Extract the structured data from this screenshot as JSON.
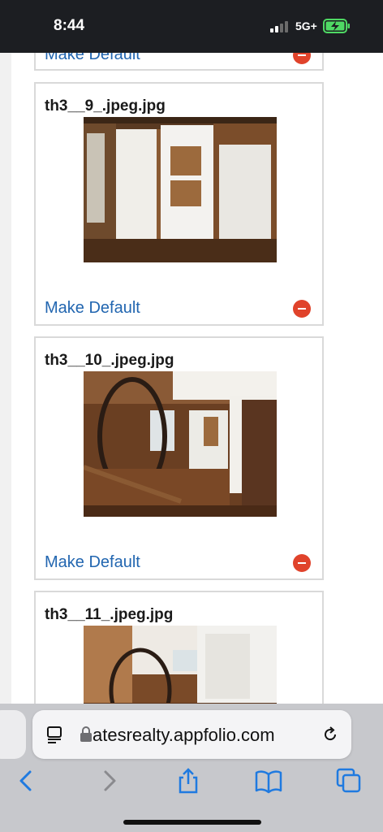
{
  "status_bar": {
    "time": "8:44",
    "network": "5G+"
  },
  "listing_photos": [
    {
      "filename": "",
      "action_label": "Make Default"
    },
    {
      "filename": "th3__9_.jpeg.jpg",
      "action_label": "Make Default"
    },
    {
      "filename": "th3__10_.jpeg.jpg",
      "action_label": "Make Default"
    },
    {
      "filename": "th3__11_.jpeg.jpg",
      "action_label": ""
    }
  ],
  "browser": {
    "url": "atesrealty.appfolio.com",
    "toolbar": [
      "back-icon",
      "forward-icon",
      "share-icon",
      "bookmarks-icon",
      "tabs-icon"
    ]
  },
  "colors": {
    "link": "#2266b0",
    "remove": "#e0432b",
    "status_bar": "#1c1e22",
    "browser_chrome": "#c7c8cc"
  }
}
